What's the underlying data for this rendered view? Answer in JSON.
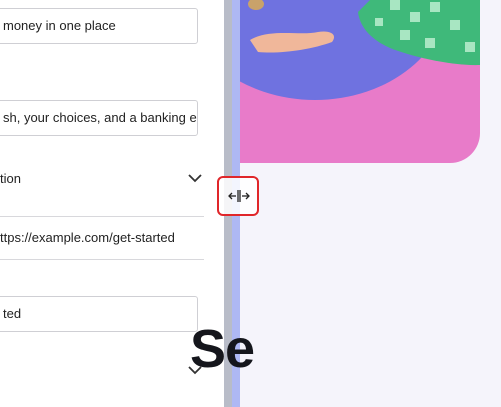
{
  "form": {
    "field_title_value": "money in one place",
    "field_description_value": "sh, your choices, and a banking e",
    "select_section_label": "tion",
    "url_value": "ttps://example.com/get-started",
    "field_cta_value": "ted"
  },
  "preview": {
    "heading": "Se"
  },
  "colors": {
    "hero_pink": "#e87bc9",
    "hero_purple": "#6f72e0",
    "highlight_red": "#e0262a",
    "divider": "#b8bcc8"
  },
  "icons": {
    "chevron": "chevron-down-icon",
    "resize": "resize-horizontal-icon"
  }
}
